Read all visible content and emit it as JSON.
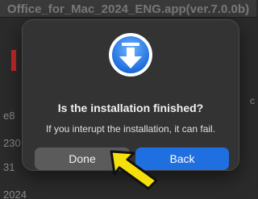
{
  "background": {
    "window_title": "Office_for_Mac_2024_ENG.app(ver.7.0.0b)",
    "left_fragments": [
      "e8",
      "230",
      "31",
      "2024"
    ]
  },
  "dialog": {
    "icon": "download-arrow-icon",
    "title": "Is the installation finished?",
    "message": "If you interupt the installation, it can fail.",
    "buttons": {
      "done_label": "Done",
      "back_label": "Back"
    }
  },
  "annotation": {
    "icon": "yellow-pointer-arrow",
    "color": "#f5e00c"
  },
  "colors": {
    "primary_button": "#1f6fe0",
    "secondary_button": "#5b5b5b",
    "dialog_bg": "#333333"
  }
}
